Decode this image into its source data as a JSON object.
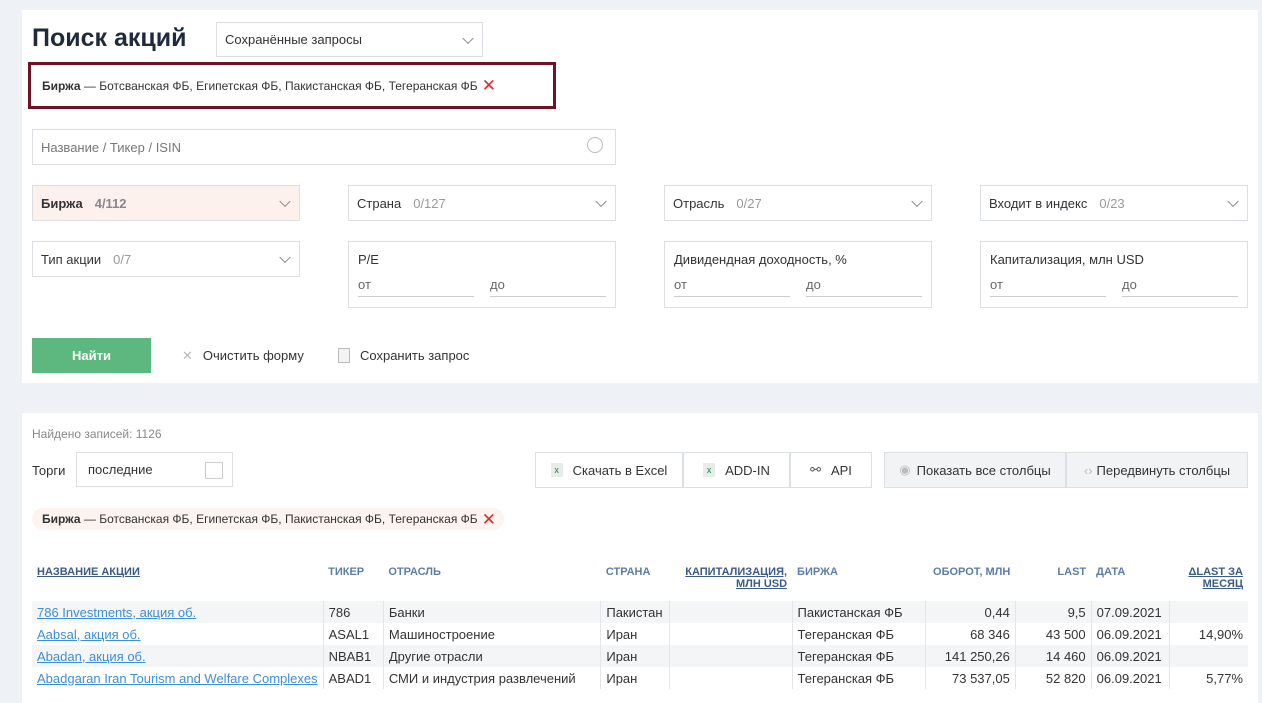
{
  "title": "Поиск акций",
  "saved_queries": "Сохранённые запросы",
  "active_filter": {
    "label": "Биржа",
    "values": "— Ботсванская ФБ, Египетская ФБ, Пакистанская ФБ, Тегеранская ФБ"
  },
  "search_placeholder": "Название / Тикер / ISIN",
  "filters": [
    {
      "label": "Биржа",
      "count": "4/112"
    },
    {
      "label": "Страна",
      "count": "0/127"
    },
    {
      "label": "Отрасль",
      "count": "0/27"
    },
    {
      "label": "Входит в индекс",
      "count": "0/23"
    },
    {
      "label": "Тип акции",
      "count": "0/7"
    }
  ],
  "ranges": [
    {
      "label": "P/E",
      "from": "от",
      "to": "до"
    },
    {
      "label": "Дивидендная доходность, %",
      "from": "от",
      "to": "до"
    },
    {
      "label": "Капитализация, млн USD",
      "from": "от",
      "to": "до"
    }
  ],
  "find": "Найти",
  "clear": "Очистить форму",
  "save": "Сохранить запрос",
  "found": "Найдено записей: 1126",
  "trades_label": "Торги",
  "trades_value": "последние",
  "toolbar": {
    "excel": "Скачать в Excel",
    "addin": "ADD-IN",
    "api": "API",
    "show_cols": "Показать все столбцы",
    "move_cols": "Передвинуть столбцы"
  },
  "table": {
    "headers": [
      "НАЗВАНИЕ АКЦИИ",
      "ТИКЕР",
      "ОТРАСЛЬ",
      "СТРАНА",
      "КАПИТАЛИЗАЦИЯ, МЛН USD",
      "БИРЖА",
      "ОБОРОТ, МЛН",
      "LAST",
      "ДАТА",
      "ΔLAST ЗА МЕСЯЦ"
    ],
    "rows": [
      [
        "786 Investments, акция об.",
        "786",
        "Банки",
        "Пакистан",
        "",
        "Пакистанская ФБ",
        "0,44",
        "9,5",
        "07.09.2021",
        ""
      ],
      [
        "Aabsal, акция об.",
        "ASAL1",
        "Машиностроение",
        "Иран",
        "",
        "Тегеранская ФБ",
        "68 346",
        "43 500",
        "06.09.2021",
        "14,90%"
      ],
      [
        "Abadan, акция об.",
        "NBAB1",
        "Другие отрасли",
        "Иран",
        "",
        "Тегеранская ФБ",
        "141 250,26",
        "14 460",
        "06.09.2021",
        ""
      ],
      [
        "Abadgaran Iran Tourism and Welfare Complexes",
        "ABAD1",
        "СМИ и индустрия развлечений",
        "Иран",
        "",
        "Тегеранская ФБ",
        "73 537,05",
        "52 820",
        "06.09.2021",
        "5,77%"
      ]
    ]
  }
}
